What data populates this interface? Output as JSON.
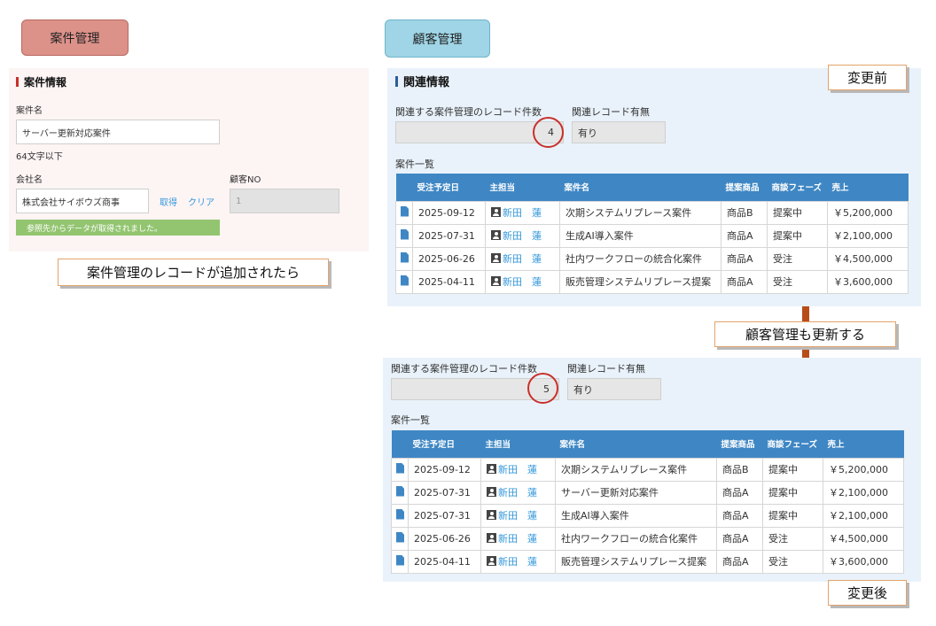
{
  "tabs": {
    "anken": "案件管理",
    "kokyaku": "顧客管理"
  },
  "left": {
    "section_title": "案件情報",
    "case_name_label": "案件名",
    "case_name_value": "サーバー更新対応案件",
    "case_name_hint": "64文字以下",
    "company_label": "会社名",
    "company_value": "株式会社サイボウズ商事",
    "get_link": "取得",
    "clear_link": "クリア",
    "customer_no_label": "顧客NO",
    "customer_no_value": "1",
    "notice": "参照先からデータが取得されました。"
  },
  "callouts": {
    "record_added": "案件管理のレコードが追加されたら",
    "before": "変更前",
    "also_updates": "顧客管理も更新する",
    "after": "変更後"
  },
  "related": {
    "section_title": "関連情報",
    "count_label": "関連する案件管理のレコード件数",
    "exists_label": "関連レコード有無",
    "list_label": "案件一覧",
    "headers": [
      "受注予定日",
      "主担当",
      "案件名",
      "提案商品",
      "商談フェーズ",
      "売上"
    ]
  },
  "before": {
    "count": "4",
    "exists": "有り",
    "rows": [
      {
        "date": "2025-09-12",
        "owner": "新田　蓮",
        "name": "次期システムリプレース案件",
        "product": "商品B",
        "phase": "提案中",
        "sales": "￥5,200,000"
      },
      {
        "date": "2025-07-31",
        "owner": "新田　蓮",
        "name": "生成AI導入案件",
        "product": "商品A",
        "phase": "提案中",
        "sales": "￥2,100,000"
      },
      {
        "date": "2025-06-26",
        "owner": "新田　蓮",
        "name": "社内ワークフローの統合化案件",
        "product": "商品A",
        "phase": "受注",
        "sales": "￥4,500,000"
      },
      {
        "date": "2025-04-11",
        "owner": "新田　蓮",
        "name": "販売管理システムリプレース提案",
        "product": "商品A",
        "phase": "受注",
        "sales": "￥3,600,000"
      }
    ]
  },
  "after": {
    "count": "5",
    "exists": "有り",
    "rows": [
      {
        "date": "2025-09-12",
        "owner": "新田　蓮",
        "name": "次期システムリプレース案件",
        "product": "商品B",
        "phase": "提案中",
        "sales": "￥5,200,000"
      },
      {
        "date": "2025-07-31",
        "owner": "新田　蓮",
        "name": "サーバー更新対応案件",
        "product": "商品A",
        "phase": "提案中",
        "sales": "￥2,100,000"
      },
      {
        "date": "2025-07-31",
        "owner": "新田　蓮",
        "name": "生成AI導入案件",
        "product": "商品A",
        "phase": "提案中",
        "sales": "￥2,100,000"
      },
      {
        "date": "2025-06-26",
        "owner": "新田　蓮",
        "name": "社内ワークフローの統合化案件",
        "product": "商品A",
        "phase": "受注",
        "sales": "￥4,500,000"
      },
      {
        "date": "2025-04-11",
        "owner": "新田　蓮",
        "name": "販売管理システムリプレース提案",
        "product": "商品A",
        "phase": "受注",
        "sales": "￥3,600,000"
      }
    ]
  },
  "colors": {
    "anken_tab": "#dc9189",
    "kokyaku_tab": "#9fd5e6",
    "table_header": "#3f87c4",
    "arrow": "#b84d1a",
    "circle": "#c9302c"
  }
}
